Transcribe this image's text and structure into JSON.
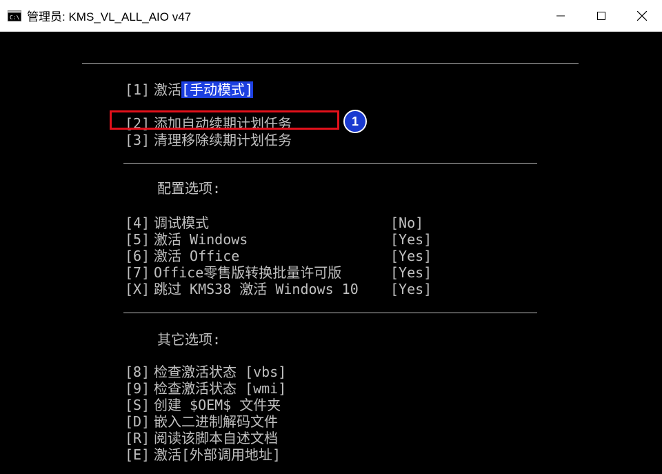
{
  "window": {
    "title": "管理员:  KMS_VL_ALL_AIO v47",
    "icon": "console-icon",
    "controls": [
      "minimize-icon",
      "maximize-icon",
      "close-icon"
    ]
  },
  "menu": {
    "main": [
      {
        "key": "[1]",
        "label": "激活",
        "mode": "[手动模式]"
      },
      {
        "key": "[2]",
        "label": "添加自动续期计划任务"
      },
      {
        "key": "[3]",
        "label": "清理移除续期计划任务"
      }
    ],
    "config_heading": "配置选项:",
    "config": [
      {
        "key": "[4]",
        "label": "调试模式",
        "value": "[No]"
      },
      {
        "key": "[5]",
        "label": "激活 Windows",
        "value": "[Yes]"
      },
      {
        "key": "[6]",
        "label": "激活 Office",
        "value": "[Yes]"
      },
      {
        "key": "[7]",
        "label": "Office零售版转换批量许可版",
        "value": "[Yes]"
      },
      {
        "key": "[X]",
        "label": "跳过 KMS38 激活 Windows 10",
        "value": "[Yes]"
      }
    ],
    "other_heading": "其它选项:",
    "other": [
      {
        "key": "[8]",
        "label": "检查激活状态 [vbs]"
      },
      {
        "key": "[9]",
        "label": "检查激活状态 [wmi]"
      },
      {
        "key": "[S]",
        "label": "创建 $OEM$ 文件夹"
      },
      {
        "key": "[D]",
        "label": "嵌入二进制解码文件"
      },
      {
        "key": "[R]",
        "label": "阅读该脚本自述文档"
      },
      {
        "key": "[E]",
        "label": "激活[外部调用地址]"
      }
    ]
  },
  "annotation": {
    "badge": "1",
    "box_color": "#e2111b",
    "badge_color": "#1a3ad0"
  },
  "colors": {
    "console_bg": "#000000",
    "console_text": "#c0c0c0",
    "highlight_bg": "#1c3fe0"
  }
}
